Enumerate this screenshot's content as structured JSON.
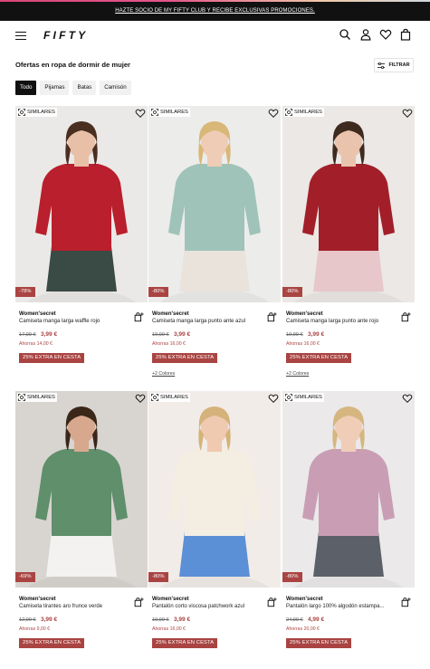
{
  "promo": {
    "text": "HAZTE SOCIO DE MY FIFTY CLUB Y RECIBE EXCLUSIVAS PROMOCIONES."
  },
  "header": {
    "logo": "FIFTY",
    "icons": [
      "menu-icon",
      "search-icon",
      "user-icon",
      "heart-icon",
      "bag-icon"
    ]
  },
  "page": {
    "title": "Ofertas en ropa de dormir de mujer",
    "filter_label": "FILTRAR"
  },
  "chips": [
    "Todo",
    "Pijamas",
    "Batas",
    "Camisón"
  ],
  "active_chip": "Todo",
  "labels": {
    "similares": "SIMILARES"
  },
  "products": [
    {
      "brand": "Women'secret",
      "name": "Camiseta manga larga waffle rojo",
      "old_price": "17,99 €",
      "price": "3,99 €",
      "saving": "Ahorras 14,00 €",
      "discount": "-78%",
      "promo": "25% EXTRA EN CESTA",
      "colors": "",
      "top_color": "#b91f2c",
      "bottom_color": "#3a4a45",
      "bg_color": "#ebe9e7",
      "skin": "#e8c0a8",
      "hair": "#4a2e20"
    },
    {
      "brand": "Women'secret",
      "name": "Camiseta manga larga punto ante azul",
      "old_price": "19,99 €",
      "price": "3,99 €",
      "saving": "Ahorras 16,00 €",
      "discount": "-80%",
      "promo": "25% EXTRA EN CESTA",
      "colors": "+2 Colores",
      "top_color": "#9fc3b9",
      "bottom_color": "#e9e3dc",
      "bg_color": "#ececeb",
      "skin": "#efccb6",
      "hair": "#d9b778"
    },
    {
      "brand": "Women'secret",
      "name": "Camiseta manga larga punto ante rojo",
      "old_price": "19,99 €",
      "price": "3,99 €",
      "saving": "Ahorras 16,00 €",
      "discount": "-80%",
      "promo": "25% EXTRA EN CESTA",
      "colors": "+2 Colores",
      "top_color": "#a21f2a",
      "bottom_color": "#e7c7c9",
      "bg_color": "#ebe8e5",
      "skin": "#e9c3ac",
      "hair": "#3e2a1f"
    },
    {
      "brand": "Women'secret",
      "name": "Camiseta tirantes aro frunce verde",
      "old_price": "12,99 €",
      "price": "3,99 €",
      "saving": "Ahorras 9,00 €",
      "discount": "-69%",
      "promo": "25% EXTRA EN CESTA",
      "colors": "",
      "top_color": "#5f8f6b",
      "bottom_color": "#f4f2f1",
      "bg_color": "#d8d4d0",
      "skin": "#d7a88e",
      "hair": "#3b2719"
    },
    {
      "brand": "Women'secret",
      "name": "Pantalón corto viscosa patchwork azul",
      "old_price": "19,99 €",
      "price": "3,99 €",
      "saving": "Ahorras 16,00 €",
      "discount": "-80%",
      "promo": "25% EXTRA EN CESTA",
      "colors": "",
      "top_color": "#f3ede2",
      "bottom_color": "#5b8fd6",
      "bg_color": "#f1ece8",
      "skin": "#efc9b0",
      "hair": "#d5b27a"
    },
    {
      "brand": "Women'secret",
      "name": "Pantalón largo 100% algodón estampa...",
      "old_price": "24,99 €",
      "price": "4,99 €",
      "saving": "Ahorras 20,00 €",
      "discount": "-80%",
      "promo": "25% EXTRA EN CESTA",
      "colors": "",
      "top_color": "#c99eb5",
      "bottom_color": "#5c6068",
      "bg_color": "#ebe9e9",
      "skin": "#efcdb7",
      "hair": "#d6b680"
    }
  ]
}
